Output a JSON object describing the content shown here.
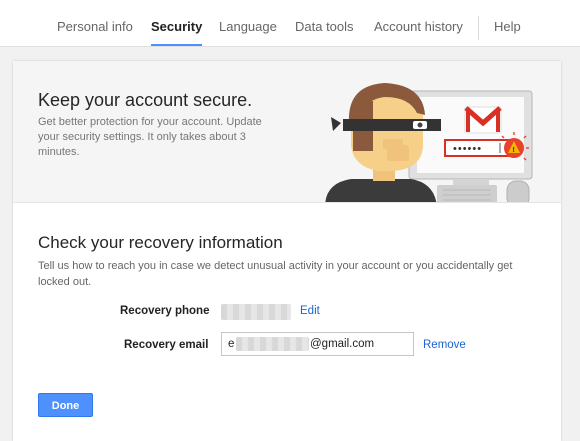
{
  "nav": {
    "tabs": [
      {
        "label": "Personal info",
        "active": false
      },
      {
        "label": "Security",
        "active": true
      },
      {
        "label": "Language",
        "active": false
      },
      {
        "label": "Data tools",
        "active": false
      },
      {
        "label": "Account history",
        "active": false
      },
      {
        "label": "Help",
        "active": false
      }
    ]
  },
  "hero": {
    "title": "Keep your account secure.",
    "description": "Get better protection for your account. Update your security settings. It only takes about 3 minutes.",
    "password_mask": "••••••"
  },
  "recovery": {
    "title": "Check your recovery information",
    "description": "Tell us how to reach you in case we detect unusual activity in your account or you accidentally get locked out.",
    "phone": {
      "label": "Recovery phone",
      "action": "Edit"
    },
    "email": {
      "label": "Recovery email",
      "value_visible": "@gmail.com",
      "prefix_visible": "e",
      "action": "Remove"
    }
  },
  "footer": {
    "done_label": "Done"
  },
  "colors": {
    "accent": "#4d90fe",
    "link": "#1a64d6",
    "warning": "#e8412c",
    "gmail_red": "#d93025"
  }
}
